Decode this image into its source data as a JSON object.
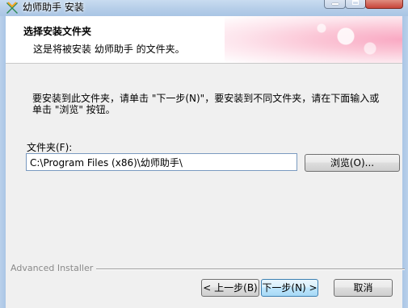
{
  "window": {
    "title": "幼师助手 安装",
    "app_icon": "installer-x-icon"
  },
  "header": {
    "title": "选择安装文件夹",
    "subtitle": "这是将被安装 幼师助手 的文件夹。"
  },
  "body": {
    "instruction": "要安装到此文件夹，请单击 \"下一步(N)\"，要安装到不同文件夹，请在下面输入或单击 \"浏览\" 按钮。",
    "folder_label": "文件夹(F):",
    "folder_path": "C:\\Program Files (x86)\\幼师助手\\",
    "browse_label": "浏览(O)..."
  },
  "footer": {
    "brand": "Advanced Installer",
    "back_label": "< 上一步(B)",
    "next_label": "下一步(N) >",
    "cancel_label": "取消"
  }
}
